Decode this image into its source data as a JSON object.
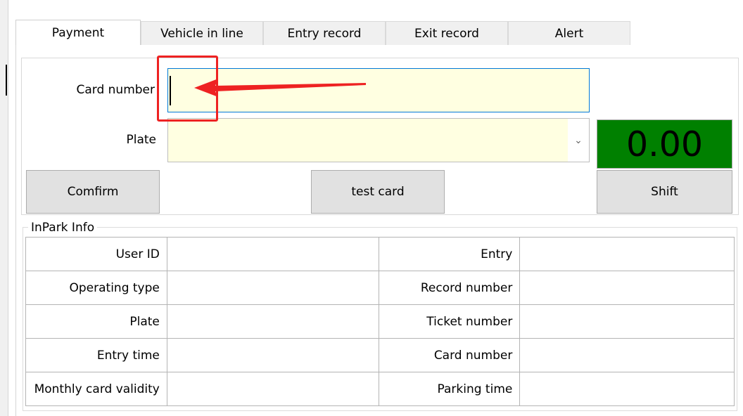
{
  "tabs": [
    {
      "label": "Payment",
      "active": true
    },
    {
      "label": "Vehicle in line",
      "active": false
    },
    {
      "label": "Entry record",
      "active": false
    },
    {
      "label": "Exit record",
      "active": false
    },
    {
      "label": "Alert",
      "active": false
    }
  ],
  "form": {
    "card_number_label": "Card number",
    "card_number_value": "",
    "plate_label": "Plate",
    "plate_value": "",
    "amount": "0.00"
  },
  "buttons": {
    "confirm": "Comfirm",
    "test_card": "test card",
    "shift": "Shift"
  },
  "inpark_info": {
    "title": "InPark Info",
    "rows": [
      {
        "left_label": "User ID",
        "left_value": "",
        "right_label": "Entry",
        "right_value": ""
      },
      {
        "left_label": "Operating type",
        "left_value": "",
        "right_label": "Record number",
        "right_value": ""
      },
      {
        "left_label": "Plate",
        "left_value": "",
        "right_label": "Ticket number",
        "right_value": ""
      },
      {
        "left_label": "Entry time",
        "left_value": "",
        "right_label": "Card number",
        "right_value": ""
      },
      {
        "left_label": "Monthly card validity",
        "left_value": "",
        "right_label": "Parking time",
        "right_value": ""
      }
    ]
  },
  "colors": {
    "input_bg": "#ffffe1",
    "amount_bg": "#008000",
    "annotation": "#ee2222",
    "focus_border": "#0078d7"
  }
}
